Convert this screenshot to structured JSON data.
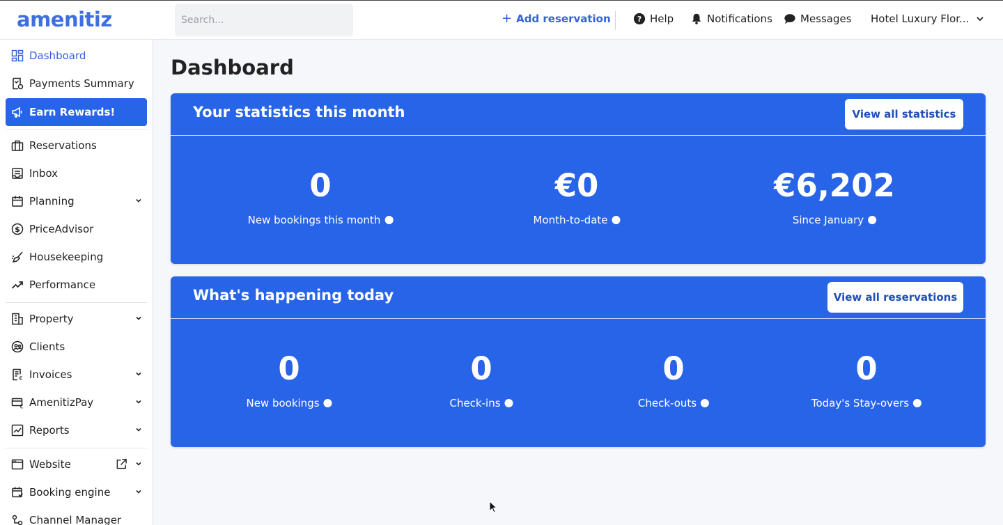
{
  "header": {
    "logo": "amenitiz",
    "search_placeholder": "Search...",
    "add_reservation": "Add reservation",
    "help": "Help",
    "notifications": "Notifications",
    "messages": "Messages",
    "hotel_name": "Hotel Luxury Flor..."
  },
  "sidebar": {
    "items": [
      {
        "label": "Dashboard",
        "icon": "dashboard-icon",
        "active": true
      },
      {
        "label": "Payments Summary",
        "icon": "payments-icon"
      },
      {
        "label": "Earn Rewards!",
        "icon": "megaphone-icon",
        "highlight": true
      },
      {
        "label": "Reservations",
        "icon": "briefcase-icon"
      },
      {
        "label": "Inbox",
        "icon": "inbox-icon"
      },
      {
        "label": "Planning",
        "icon": "calendar-icon",
        "expandable": true
      },
      {
        "label": "PriceAdvisor",
        "icon": "dollar-icon"
      },
      {
        "label": "Housekeeping",
        "icon": "broom-icon"
      },
      {
        "label": "Performance",
        "icon": "trend-icon"
      },
      {
        "label": "Property",
        "icon": "building-icon",
        "expandable": true
      },
      {
        "label": "Clients",
        "icon": "clients-icon"
      },
      {
        "label": "Invoices",
        "icon": "invoice-icon",
        "expandable": true
      },
      {
        "label": "AmenitizPay",
        "icon": "card-icon",
        "expandable": true
      },
      {
        "label": "Reports",
        "icon": "chart-icon",
        "expandable": true
      },
      {
        "label": "Website",
        "icon": "browser-icon",
        "expandable": true,
        "external": true
      },
      {
        "label": "Booking engine",
        "icon": "booking-icon",
        "expandable": true
      },
      {
        "label": "Channel Manager",
        "icon": "channel-icon"
      }
    ]
  },
  "main": {
    "title": "Dashboard",
    "stats_card": {
      "title": "Your statistics this month",
      "button": "View all statistics",
      "stats": [
        {
          "value": "0",
          "label": "New bookings this month"
        },
        {
          "value": "€0",
          "label": "Month-to-date"
        },
        {
          "value": "€6,202",
          "label": "Since January"
        }
      ]
    },
    "today_card": {
      "title": "What's happening today",
      "button": "View all reservations",
      "stats": [
        {
          "value": "0",
          "label": "New bookings"
        },
        {
          "value": "0",
          "label": "Check-ins"
        },
        {
          "value": "0",
          "label": "Check-outs"
        },
        {
          "value": "0",
          "label": "Today's Stay-overs"
        }
      ]
    }
  },
  "colors": {
    "primary": "#2864e8",
    "link": "#3462d9",
    "background": "#f5f7fa"
  }
}
